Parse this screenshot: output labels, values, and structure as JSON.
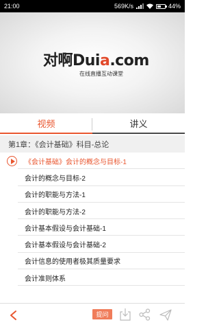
{
  "status_bar": {
    "time": "21:00",
    "net_speed": "569K/s",
    "battery": "44%",
    "battery_level": 0.44
  },
  "video": {
    "logo_text_before": "对啊Dui",
    "logo_text_accent": "a",
    "logo_text_after": ".com",
    "logo_tagline": "在线直播互动课堂"
  },
  "tabs": [
    {
      "label": "视频",
      "active": true
    },
    {
      "label": "讲义",
      "active": false
    }
  ],
  "chapter": {
    "title": "第1章：《会计基础》科目-总论"
  },
  "lessons": [
    {
      "title": "《会计基础》会计的概念与目标-1",
      "active": true
    },
    {
      "title": "会计的概念与目标-2",
      "active": false
    },
    {
      "title": "会计的职能与方法-1",
      "active": false
    },
    {
      "title": "会计的职能与方法-2",
      "active": false
    },
    {
      "title": "会计基本假设与会计基础-1",
      "active": false
    },
    {
      "title": "会计基本假设与会计基础-2",
      "active": false
    },
    {
      "title": "会计信息的使用者极其质量要求",
      "active": false
    },
    {
      "title": "会计准则体系",
      "active": false
    }
  ],
  "bottom_bar": {
    "ask_label": "提问"
  },
  "colors": {
    "accent": "#e9562f",
    "ask_button": "#f07c5a"
  }
}
